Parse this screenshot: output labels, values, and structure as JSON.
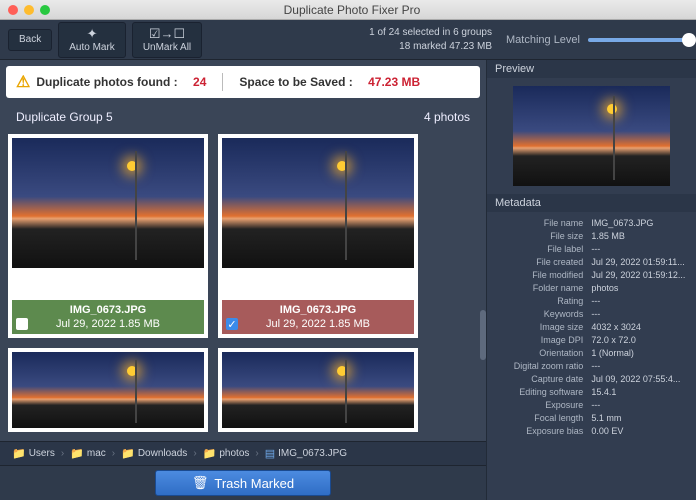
{
  "title": "Duplicate Photo Fixer Pro",
  "toolbar": {
    "back": "Back",
    "automark": "Auto Mark",
    "unmark": "UnMark All",
    "status1": "1 of 24 selected in 6 groups",
    "status2": "18 marked 47.23 MB",
    "matching": "Matching Level"
  },
  "info": {
    "found_label": "Duplicate photos found :",
    "found_value": "24",
    "space_label": "Space to be Saved :",
    "space_value": "47.23 MB"
  },
  "group": {
    "name": "Duplicate Group 5",
    "count": "4 photos"
  },
  "cards": [
    {
      "name": "IMG_0673.JPG",
      "date": "Jul 29, 2022 1.85 MB",
      "marked": false,
      "bad": false
    },
    {
      "name": "IMG_0673.JPG",
      "date": "Jul 29, 2022 1.85 MB",
      "marked": true,
      "bad": true
    }
  ],
  "breadcrumbs": [
    "Users",
    "mac",
    "Downloads",
    "photos",
    "IMG_0673.JPG"
  ],
  "footer_btn": "Trash Marked",
  "side": {
    "preview": "Preview",
    "meta": "Metadata"
  },
  "metadata": [
    [
      "File name",
      "IMG_0673.JPG"
    ],
    [
      "File size",
      "1.85 MB"
    ],
    [
      "File label",
      "---"
    ],
    [
      "File created",
      "Jul 29, 2022 01:59:11..."
    ],
    [
      "File modified",
      "Jul 29, 2022 01:59:12..."
    ],
    [
      "Folder name",
      "photos"
    ],
    [
      "Rating",
      "---"
    ],
    [
      "Keywords",
      "---"
    ],
    [
      "Image size",
      "4032 x 3024"
    ],
    [
      "Image DPI",
      "72.0 x 72.0"
    ],
    [
      "Orientation",
      "1 (Normal)"
    ],
    [
      "Digital zoom ratio",
      "---"
    ],
    [
      "Capture date",
      "Jul 09, 2022 07:55:4..."
    ],
    [
      "Editing software",
      "15.4.1"
    ],
    [
      "Exposure",
      "---"
    ],
    [
      "Focal length",
      "5.1 mm"
    ],
    [
      "Exposure bias",
      "0.00 EV"
    ]
  ]
}
